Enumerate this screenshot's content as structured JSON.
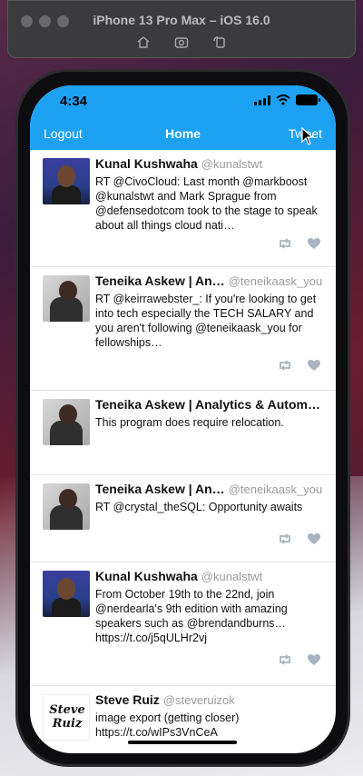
{
  "simulator": {
    "title": "iPhone 13 Pro Max – iOS 16.0",
    "toolbar_icons": [
      "home-icon",
      "screenshot-icon",
      "rotate-icon"
    ]
  },
  "status_bar": {
    "time": "4:34"
  },
  "nav": {
    "left": "Logout",
    "title": "Home",
    "right": "Tweet"
  },
  "colors": {
    "header": "#1da1f2",
    "icon_gray": "#a8b4bf"
  },
  "tweets": [
    {
      "name": "Kunal Kushwaha",
      "handle": "@kunalstwt",
      "text": "RT @CivoCloud: Last month @markboost @kunalstwt and Mark Sprague from @defensedotcom took to the stage to speak about all things cloud nati…",
      "avatar": "kunal"
    },
    {
      "name": "Teneika Askew | An…",
      "handle": "@teneikaask_you",
      "text": "RT @keirrawebster_: If you're looking to get into tech especially the TECH SALARY and you aren't following @teneikaask_you for fellowships…",
      "avatar": "teneika"
    },
    {
      "name": "Teneika Askew | Analytics & Autom…",
      "handle": "",
      "text": "This program does require relocation.",
      "avatar": "teneika"
    },
    {
      "name": "Teneika Askew | An…",
      "handle": "@teneikaask_you",
      "text": "RT @crystal_theSQL: Opportunity awaits",
      "avatar": "teneika"
    },
    {
      "name": "Kunal Kushwaha",
      "handle": "@kunalstwt",
      "text": "From October 19th to the 22nd, join @nerdearla's 9th edition with amazing speakers such as @brendandburns… https://t.co/j5qULHr2vj",
      "avatar": "kunal"
    },
    {
      "name": "Steve Ruiz",
      "handle": "@steveruizok",
      "text": "image export (getting closer) https://t.co/wIPs3VnCeA",
      "avatar": "steve",
      "avatar_text": "Steve Ruiz"
    }
  ]
}
